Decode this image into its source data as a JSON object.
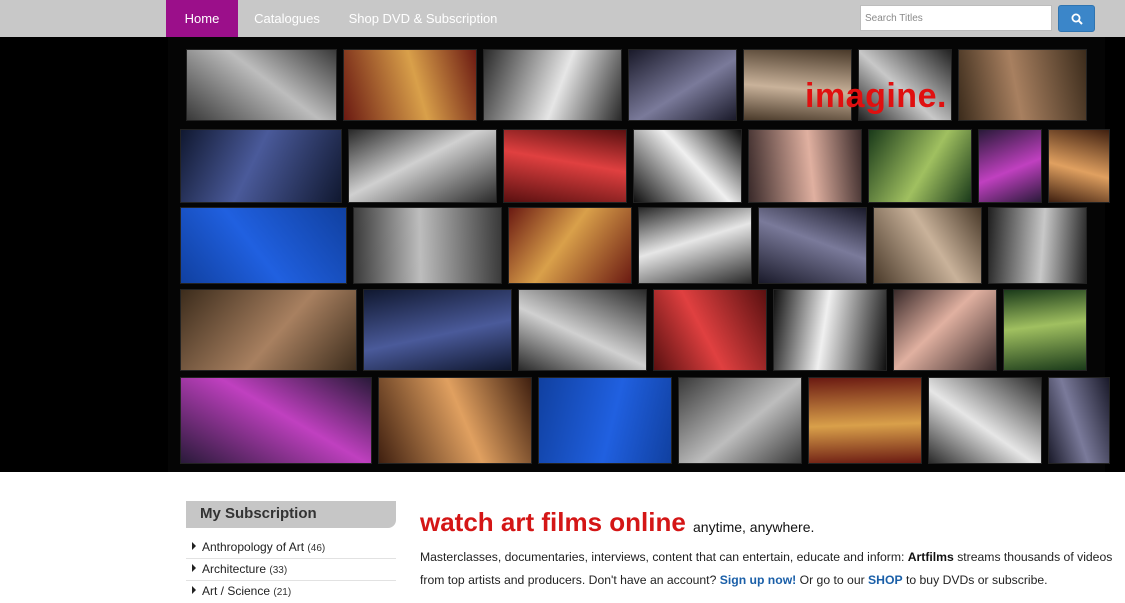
{
  "nav": {
    "items": [
      {
        "label": "Home",
        "active": true
      },
      {
        "label": "Catalogues"
      },
      {
        "label": "Shop DVD & Subscription"
      }
    ],
    "search_placeholder": "Search Titles",
    "search_icon": "magnifier-icon",
    "active_color": "#9b0f8a",
    "search_button_color": "#3b86c9"
  },
  "hero": {
    "headline": "imagine.",
    "headline_color": "#e01010"
  },
  "sidebar": {
    "title": "My Subscription",
    "categories": [
      {
        "name": "Anthropology of Art",
        "count": "(46)"
      },
      {
        "name": "Architecture",
        "count": "(33)"
      },
      {
        "name": "Art / Science",
        "count": "(21)"
      }
    ]
  },
  "main": {
    "title": "watch art films online",
    "tagline": "anytime, anywhere.",
    "line1_a": "Masterclasses, documentaries, interviews, content that can entertain, educate and inform: ",
    "brand": "Artfilms",
    "line1_b": " streams thousands of videos",
    "line2_a": "from top artists and producers. Don't have an account? ",
    "signup_link": "Sign up now!",
    "line2_b": " Or go to our ",
    "shop_link": "SHOP",
    "line2_c": " to buy DVDs or subscribe.",
    "title_color": "#d41616",
    "link_color": "#1a5fa8"
  }
}
